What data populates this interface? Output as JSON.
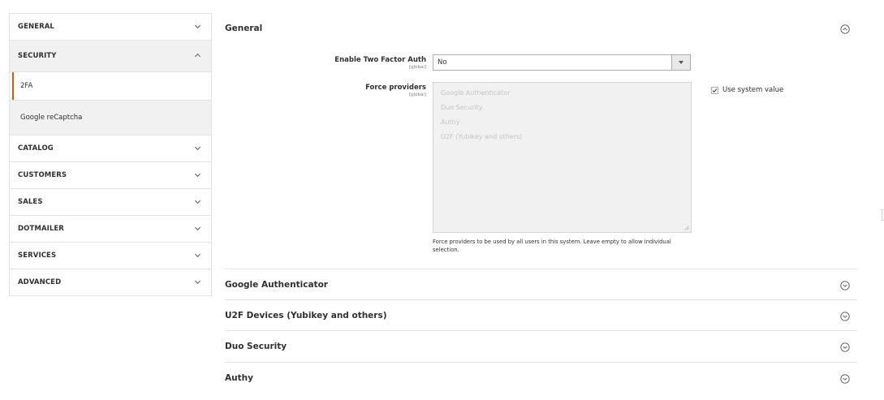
{
  "sidebar": {
    "tabs": [
      {
        "label": "GENERAL",
        "open": false
      },
      {
        "label": "SECURITY",
        "open": true
      },
      {
        "label": "CATALOG",
        "open": false
      },
      {
        "label": "CUSTOMERS",
        "open": false
      },
      {
        "label": "SALES",
        "open": false
      },
      {
        "label": "DOTMAILER",
        "open": false
      },
      {
        "label": "SERVICES",
        "open": false
      },
      {
        "label": "ADVANCED",
        "open": false
      }
    ],
    "security_items": [
      {
        "label": "2FA",
        "active": true
      },
      {
        "label": "Google reCaptcha",
        "active": false
      }
    ]
  },
  "main": {
    "general": {
      "title": "General",
      "enable_2fa": {
        "label": "Enable Two Factor Auth",
        "scope": "[global]",
        "value": "No"
      },
      "force_providers": {
        "label": "Force providers",
        "scope": "[global]",
        "options": [
          "Google Authenticator",
          "Duo Security",
          "Authy",
          "U2F (Yubikey and others)"
        ],
        "note": "Force providers to be used by all users in this system. Leave empty to allow individual selection.",
        "use_system_value": {
          "label": "Use system value",
          "checked": true
        }
      }
    },
    "sections": [
      {
        "title": "Google Authenticator"
      },
      {
        "title": "U2F Devices (Yubikey and others)"
      },
      {
        "title": "Duo Security"
      },
      {
        "title": "Authy"
      }
    ]
  },
  "icons": {
    "chevron_down": "chevron-down-icon",
    "chevron_up": "chevron-up-icon",
    "circle_chevron_up": "circle-chevron-up-icon",
    "circle_chevron_down": "circle-chevron-down-icon",
    "checkmark": "checkmark-icon"
  },
  "colors": {
    "accent": "#eb5202",
    "border": "#e3e3e3",
    "open_tab_bg": "#f1f1f1",
    "disabled_text": "#c4c4c4"
  }
}
